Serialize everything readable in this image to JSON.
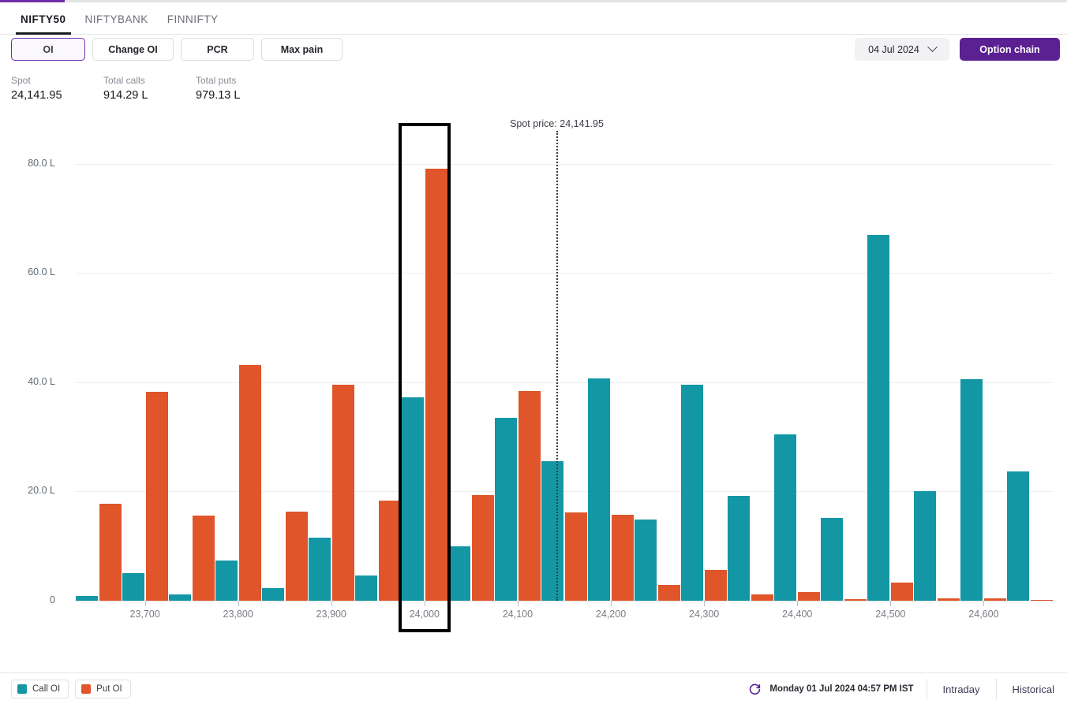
{
  "tabs": [
    {
      "label": "NIFTY50",
      "active": true
    },
    {
      "label": "NIFTYBANK",
      "active": false
    },
    {
      "label": "FINNIFTY",
      "active": false
    }
  ],
  "toolbar": {
    "oi_label": "OI",
    "change_oi_label": "Change OI",
    "pcr_label": "PCR",
    "max_pain_label": "Max pain",
    "expiry_date": "04 Jul 2024",
    "option_chain_label": "Option chain",
    "chevron_icon": "chevron-down-icon"
  },
  "stats": {
    "spot_label": "Spot",
    "spot_value": "24,141.95",
    "total_calls_label": "Total calls",
    "total_calls_value": "914.29 L",
    "total_puts_label": "Total puts",
    "total_puts_value": "979.13 L"
  },
  "footer": {
    "legend": [
      {
        "label": "Call OI",
        "color": "#1397a4"
      },
      {
        "label": "Put OI",
        "color": "#e0552a"
      }
    ],
    "refresh_icon": "refresh-icon",
    "timestamp": "Monday 01 Jul 2024 04:57 PM IST",
    "intraday_label": "Intraday",
    "historical_label": "Historical"
  },
  "colors": {
    "call": "#1397a4",
    "put": "#e0552a",
    "accent": "#5b2091",
    "accent_outline": "#6f2da8",
    "highlight_border": "#000000"
  },
  "chart_data": {
    "type": "bar",
    "title": "",
    "xlabel": "",
    "ylabel": "",
    "unit": "L",
    "ylim": [
      0,
      86
    ],
    "yticks": [
      0,
      20,
      40,
      60,
      80
    ],
    "ytick_labels": [
      "0",
      "20.0 L",
      "40.0 L",
      "60.0 L",
      "80.0 L"
    ],
    "grid": true,
    "legend_position": "bottom-left",
    "strike_step": 50,
    "labeled_ticks": [
      23700,
      23800,
      23900,
      24000,
      24100,
      24200,
      24300,
      24400,
      24500,
      24600
    ],
    "xtick_labels": [
      "23,700",
      "23,800",
      "23,900",
      "24,000",
      "24,100",
      "24,200",
      "24,300",
      "24,400",
      "24,500",
      "24,600"
    ],
    "categories": [
      23650,
      23700,
      23750,
      23800,
      23850,
      23900,
      23950,
      24000,
      24050,
      24100,
      24150,
      24200,
      24250,
      24300,
      24350,
      24400,
      24450,
      24500,
      24550,
      24600,
      24650
    ],
    "series": [
      {
        "name": "Call OI",
        "color": "#1397a4",
        "values": [
          0.8,
          5.1,
          1.1,
          7.3,
          2.3,
          11.5,
          4.6,
          37.3,
          10.0,
          33.5,
          25.5,
          40.7,
          14.8,
          39.5,
          19.2,
          30.4,
          15.1,
          66.9,
          20.0,
          40.5,
          23.7
        ]
      },
      {
        "name": "Put OI",
        "color": "#e0552a",
        "values": [
          17.8,
          38.3,
          15.6,
          43.2,
          16.3,
          39.5,
          18.3,
          79.1,
          19.3,
          38.4,
          16.2,
          15.7,
          2.9,
          5.6,
          1.2,
          1.6,
          0.3,
          3.3,
          0.4,
          0.5,
          0.2
        ]
      }
    ],
    "annotations": [
      {
        "type": "vline",
        "label": "Spot price: 24,141.95",
        "value": 24141.95,
        "style": "dotted"
      },
      {
        "type": "highlight",
        "label": "24,000",
        "value": 24000
      }
    ]
  }
}
